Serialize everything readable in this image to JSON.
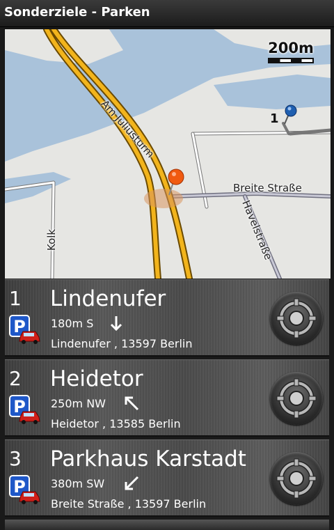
{
  "header": {
    "title": "Sonderziele - Parken"
  },
  "map": {
    "scale_label": "200m",
    "marker_number": "1",
    "streets": {
      "juliusturm": "Am Juliusturm",
      "breite": "Breite Straße",
      "havel": "Havelstraße",
      "kolk": "Kolk"
    },
    "colors": {
      "water": "#a9c2da",
      "land": "#e6e6e3",
      "major_road": "#f2b41c",
      "minor_road": "#8a8a94"
    }
  },
  "results": [
    {
      "index": "1",
      "name": "Lindenufer",
      "distance": "180m S",
      "direction": "south",
      "address": "Lindenufer , 13597 Berlin",
      "icon": "parking-icon"
    },
    {
      "index": "2",
      "name": "Heidetor",
      "distance": "250m NW",
      "direction": "north-west",
      "address": "Heidetor , 13585 Berlin",
      "icon": "parking-icon"
    },
    {
      "index": "3",
      "name": "Parkhaus Karstadt",
      "distance": "380m SW",
      "direction": "south-west",
      "address": "Breite Straße , 13597 Berlin",
      "icon": "parking-icon"
    }
  ]
}
